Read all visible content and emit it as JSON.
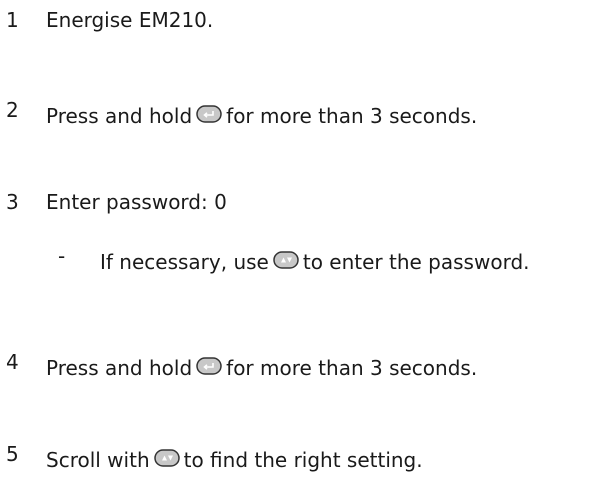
{
  "steps": [
    {
      "number": "1",
      "text": "Energise EM210."
    },
    {
      "number": "2",
      "text_before": "Press and hold",
      "icon": "enter-key-icon",
      "text_after": "for more than 3 seconds."
    },
    {
      "number": "3",
      "text": "Enter password: 0"
    },
    {
      "number": "4",
      "text_before": "Press and hold",
      "icon": "enter-key-icon",
      "text_after": "for more than 3 seconds."
    },
    {
      "number": "5",
      "text_before": "Scroll with",
      "icon": "up-down-key-icon",
      "text_after": "to find the right setting."
    }
  ],
  "substep": {
    "bullet": "-",
    "text_before": "If necessary, use",
    "icon": "up-down-key-icon",
    "text_after": "to enter the password."
  },
  "colors": {
    "text": "#1a1a1a",
    "key_fill": "#c8c8c8",
    "key_border": "#333333"
  }
}
